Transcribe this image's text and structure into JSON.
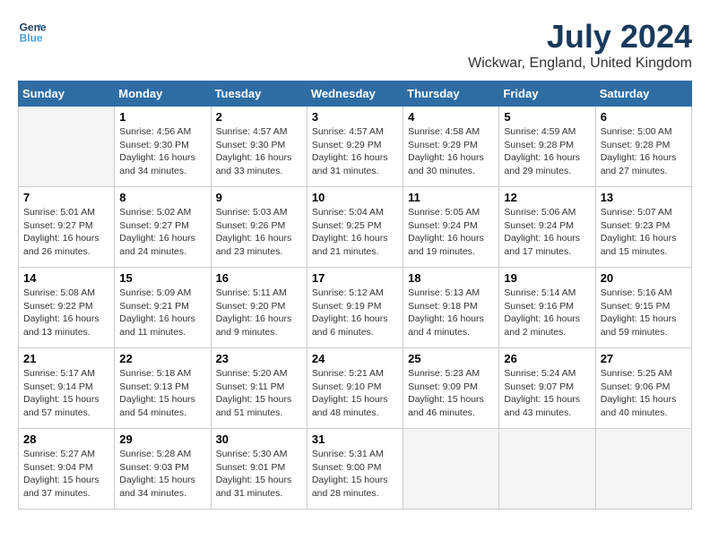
{
  "logo": {
    "line1": "General",
    "line2": "Blue"
  },
  "title": "July 2024",
  "location": "Wickwar, England, United Kingdom",
  "days_of_week": [
    "Sunday",
    "Monday",
    "Tuesday",
    "Wednesday",
    "Thursday",
    "Friday",
    "Saturday"
  ],
  "weeks": [
    [
      {
        "day": "",
        "info": ""
      },
      {
        "day": "1",
        "info": "Sunrise: 4:56 AM\nSunset: 9:30 PM\nDaylight: 16 hours\nand 34 minutes."
      },
      {
        "day": "2",
        "info": "Sunrise: 4:57 AM\nSunset: 9:30 PM\nDaylight: 16 hours\nand 33 minutes."
      },
      {
        "day": "3",
        "info": "Sunrise: 4:57 AM\nSunset: 9:29 PM\nDaylight: 16 hours\nand 31 minutes."
      },
      {
        "day": "4",
        "info": "Sunrise: 4:58 AM\nSunset: 9:29 PM\nDaylight: 16 hours\nand 30 minutes."
      },
      {
        "day": "5",
        "info": "Sunrise: 4:59 AM\nSunset: 9:28 PM\nDaylight: 16 hours\nand 29 minutes."
      },
      {
        "day": "6",
        "info": "Sunrise: 5:00 AM\nSunset: 9:28 PM\nDaylight: 16 hours\nand 27 minutes."
      }
    ],
    [
      {
        "day": "7",
        "info": "Sunrise: 5:01 AM\nSunset: 9:27 PM\nDaylight: 16 hours\nand 26 minutes."
      },
      {
        "day": "8",
        "info": "Sunrise: 5:02 AM\nSunset: 9:27 PM\nDaylight: 16 hours\nand 24 minutes."
      },
      {
        "day": "9",
        "info": "Sunrise: 5:03 AM\nSunset: 9:26 PM\nDaylight: 16 hours\nand 23 minutes."
      },
      {
        "day": "10",
        "info": "Sunrise: 5:04 AM\nSunset: 9:25 PM\nDaylight: 16 hours\nand 21 minutes."
      },
      {
        "day": "11",
        "info": "Sunrise: 5:05 AM\nSunset: 9:24 PM\nDaylight: 16 hours\nand 19 minutes."
      },
      {
        "day": "12",
        "info": "Sunrise: 5:06 AM\nSunset: 9:24 PM\nDaylight: 16 hours\nand 17 minutes."
      },
      {
        "day": "13",
        "info": "Sunrise: 5:07 AM\nSunset: 9:23 PM\nDaylight: 16 hours\nand 15 minutes."
      }
    ],
    [
      {
        "day": "14",
        "info": "Sunrise: 5:08 AM\nSunset: 9:22 PM\nDaylight: 16 hours\nand 13 minutes."
      },
      {
        "day": "15",
        "info": "Sunrise: 5:09 AM\nSunset: 9:21 PM\nDaylight: 16 hours\nand 11 minutes."
      },
      {
        "day": "16",
        "info": "Sunrise: 5:11 AM\nSunset: 9:20 PM\nDaylight: 16 hours\nand 9 minutes."
      },
      {
        "day": "17",
        "info": "Sunrise: 5:12 AM\nSunset: 9:19 PM\nDaylight: 16 hours\nand 6 minutes."
      },
      {
        "day": "18",
        "info": "Sunrise: 5:13 AM\nSunset: 9:18 PM\nDaylight: 16 hours\nand 4 minutes."
      },
      {
        "day": "19",
        "info": "Sunrise: 5:14 AM\nSunset: 9:16 PM\nDaylight: 16 hours\nand 2 minutes."
      },
      {
        "day": "20",
        "info": "Sunrise: 5:16 AM\nSunset: 9:15 PM\nDaylight: 15 hours\nand 59 minutes."
      }
    ],
    [
      {
        "day": "21",
        "info": "Sunrise: 5:17 AM\nSunset: 9:14 PM\nDaylight: 15 hours\nand 57 minutes."
      },
      {
        "day": "22",
        "info": "Sunrise: 5:18 AM\nSunset: 9:13 PM\nDaylight: 15 hours\nand 54 minutes."
      },
      {
        "day": "23",
        "info": "Sunrise: 5:20 AM\nSunset: 9:11 PM\nDaylight: 15 hours\nand 51 minutes."
      },
      {
        "day": "24",
        "info": "Sunrise: 5:21 AM\nSunset: 9:10 PM\nDaylight: 15 hours\nand 48 minutes."
      },
      {
        "day": "25",
        "info": "Sunrise: 5:23 AM\nSunset: 9:09 PM\nDaylight: 15 hours\nand 46 minutes."
      },
      {
        "day": "26",
        "info": "Sunrise: 5:24 AM\nSunset: 9:07 PM\nDaylight: 15 hours\nand 43 minutes."
      },
      {
        "day": "27",
        "info": "Sunrise: 5:25 AM\nSunset: 9:06 PM\nDaylight: 15 hours\nand 40 minutes."
      }
    ],
    [
      {
        "day": "28",
        "info": "Sunrise: 5:27 AM\nSunset: 9:04 PM\nDaylight: 15 hours\nand 37 minutes."
      },
      {
        "day": "29",
        "info": "Sunrise: 5:28 AM\nSunset: 9:03 PM\nDaylight: 15 hours\nand 34 minutes."
      },
      {
        "day": "30",
        "info": "Sunrise: 5:30 AM\nSunset: 9:01 PM\nDaylight: 15 hours\nand 31 minutes."
      },
      {
        "day": "31",
        "info": "Sunrise: 5:31 AM\nSunset: 9:00 PM\nDaylight: 15 hours\nand 28 minutes."
      },
      {
        "day": "",
        "info": ""
      },
      {
        "day": "",
        "info": ""
      },
      {
        "day": "",
        "info": ""
      }
    ]
  ]
}
